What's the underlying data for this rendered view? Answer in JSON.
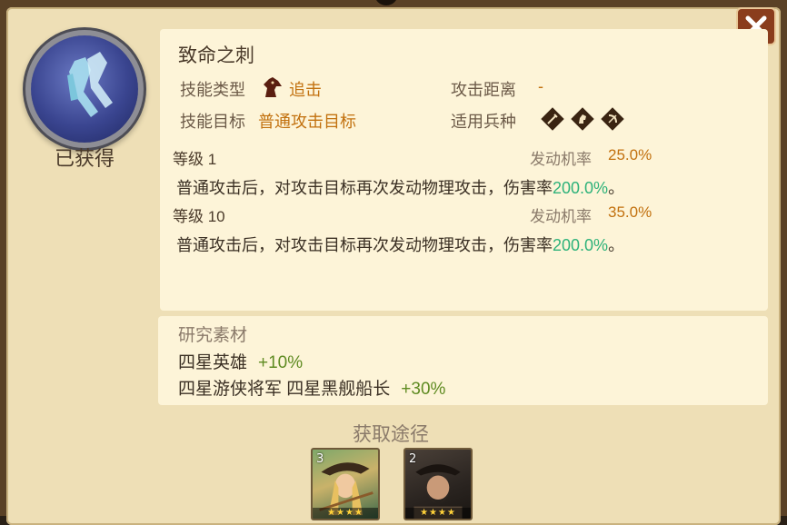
{
  "skill": {
    "name": "致命之刺",
    "status": "已获得",
    "type_label": "技能类型",
    "type_value": "追击",
    "type_icon": "horse-head-icon",
    "range_label": "攻击距离",
    "range_value": "-",
    "target_label": "技能目标",
    "target_value": "普通攻击目标",
    "troop_label": "适用兵种",
    "troop_icons": [
      "sword-icon",
      "cavalry-icon",
      "bow-icon"
    ]
  },
  "levels": [
    {
      "level_text": "等级 1",
      "rate_label": "发动机率",
      "rate_value": "25.0%",
      "desc_prefix": "普通攻击后，对攻击目标再次发动物理攻击，伤害率",
      "desc_value": "200.0%",
      "desc_suffix": "。"
    },
    {
      "level_text": "等级 10",
      "rate_label": "发动机率",
      "rate_value": "35.0%",
      "desc_prefix": "普通攻击后，对攻击目标再次发动物理攻击，伤害率",
      "desc_value": "200.0%",
      "desc_suffix": "。"
    }
  ],
  "research": {
    "title": "研究素材",
    "lines": [
      {
        "text": "四星英雄",
        "bonus": "+10%"
      },
      {
        "text": "四星游侠将军 四星黑舰船长",
        "bonus": "+30%"
      }
    ]
  },
  "obtain": {
    "title": "获取途径",
    "heroes": [
      {
        "level": "3",
        "stars": "★★★★",
        "icon": "ranger-hero-portrait"
      },
      {
        "level": "2",
        "stars": "★★★★",
        "icon": "pirate-hero-portrait"
      }
    ]
  },
  "colors": {
    "accent_orange": "#c2710f",
    "highlight_green": "#2eb27a",
    "bonus_green": "#5f8b22",
    "panel_bg": "#eedfb6",
    "box_bg": "#fdf4d8",
    "close_button": "#8a3d1c"
  }
}
